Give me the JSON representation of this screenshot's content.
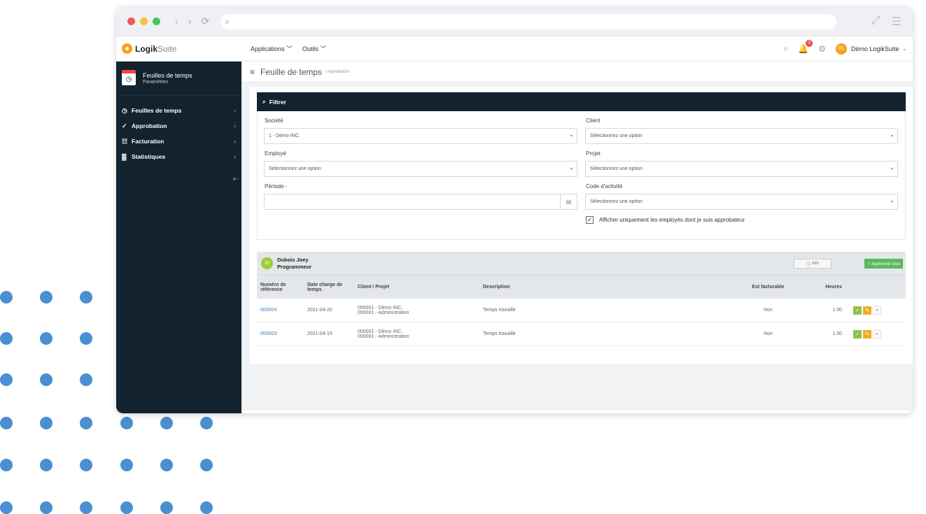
{
  "browser": {
    "url": ""
  },
  "brand": {
    "name_bold": "Logik",
    "name_light": "Suite"
  },
  "topmenu": [
    {
      "label": "Applications ﹀"
    },
    {
      "label": "Outils ﹀"
    }
  ],
  "user": {
    "initials": "DL",
    "name": "Démo LogikSuite",
    "notifications": "0"
  },
  "sidebar": {
    "module_title": "Feuilles de temps",
    "module_sub": "Paramètres",
    "items": [
      {
        "label": "Feuilles de temps",
        "icon": "clock-icon"
      },
      {
        "label": "Approbation",
        "icon": "check-icon"
      },
      {
        "label": "Facturation",
        "icon": "invoice-icon"
      },
      {
        "label": "Statistiques",
        "icon": "chart-icon"
      }
    ]
  },
  "page": {
    "title": "Feuille de temps",
    "crumb": "/ Approbation"
  },
  "filter": {
    "title": "Filtrer",
    "societe_label": "Société",
    "societe_value": "1 - Démo INC.",
    "client_label": "Client",
    "client_value": "Sélectionnez une option",
    "employe_label": "Employé",
    "employe_value": "Sélectionnez une option",
    "projet_label": "Projet",
    "projet_value": "Sélectionnez une option",
    "periode_label": "Période -",
    "periode_value": "",
    "code_label": "Code d'activité",
    "code_value": "Sélectionnez une option",
    "checkbox_label": "Afficher uniquement les employés dont je suis approbateur",
    "checkbox_checked": true
  },
  "employee": {
    "initials": "JD",
    "name": "Dubois Joey",
    "role": "Programmeur",
    "info_button": "Info",
    "approve_all": "✓ Approuver tous"
  },
  "table": {
    "headers": {
      "ref": "Numéro de référence",
      "date": "Date charge de temps",
      "client": "Client / Projet",
      "desc": "Description",
      "billable": "Est facturable",
      "hours": "Heures"
    },
    "rows": [
      {
        "ref": "000004",
        "date": "2021-04-20",
        "client": "000001 - Démo INC.",
        "projet": "000001 - Administration",
        "desc": "Temps travaillé",
        "billable": "Non",
        "hours": "1.00"
      },
      {
        "ref": "000003",
        "date": "2021-04-19",
        "client": "000001 - Démo INC.",
        "projet": "000001 - Administration",
        "desc": "Temps travaillé",
        "billable": "Non",
        "hours": "1.00"
      }
    ]
  }
}
